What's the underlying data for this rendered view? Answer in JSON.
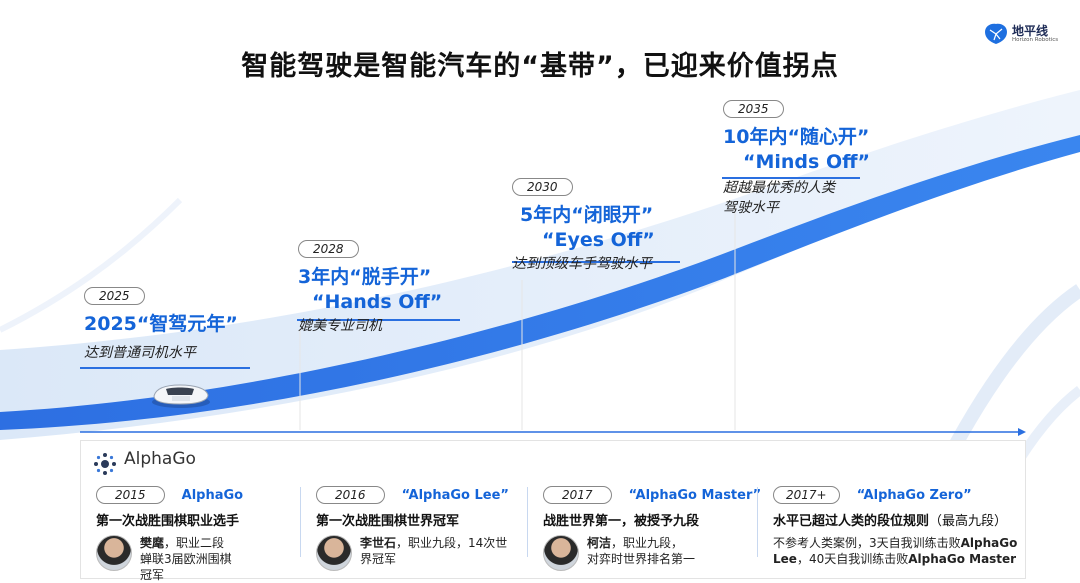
{
  "title": "智能驾驶是智能汽车的“基带”，已迎来价值拐点",
  "logo": {
    "cn": "地平线",
    "en": "Horizon Robotics"
  },
  "milestones": [
    {
      "year": "2025",
      "title": "2025“智驾元年”",
      "title2": "",
      "subtitle": "达到普通司机水平"
    },
    {
      "year": "2028",
      "title": "3年内“脱手开”",
      "title2": "“Hands Off”",
      "subtitle": "媲美专业司机"
    },
    {
      "year": "2030",
      "title": "5年内“闭眼开”",
      "title2": "“Eyes Off”",
      "subtitle": "达到顶级车手驾驶水平"
    },
    {
      "year": "2035",
      "title": "10年内“随心开”",
      "title2": "“Minds Off”",
      "subtitle": "超越最优秀的人类",
      "subtitle2": "驾驶水平"
    }
  ],
  "alphago": {
    "label": "AlphaGo",
    "columns": [
      {
        "year": "2015",
        "name": "AlphaGo",
        "desc": "第一次战胜围棋职业选手",
        "person": "樊麾",
        "person_line1": "，职业二段",
        "person_line2": "蝉联3届欧洲围棋冠军"
      },
      {
        "year": "2016",
        "name": "“AlphaGo Lee”",
        "desc": "第一次战胜围棋世界冠军",
        "person": "李世石",
        "person_line1": "，职业九段，14次世",
        "person_line2": "界冠军"
      },
      {
        "year": "2017",
        "name": "“AlphaGo Master”",
        "desc": "战胜世界第一，被授予九段",
        "person": "柯洁",
        "person_line1": "，职业九段，",
        "person_line2": "对弈时世界排名第一"
      },
      {
        "year": "2017+",
        "name": "“AlphaGo Zero”",
        "desc": "水平已超过人类的段位规则",
        "desc_suffix": "（最高九段）",
        "line1a": "不参考人类案例，3天自我训练击败",
        "line1b": "AlphaGo",
        "line2a": "Lee",
        "line2b": "，40天自我训练击败",
        "line2c": "AlphaGo Master"
      }
    ]
  },
  "colors": {
    "accent": "#1464d8",
    "road": "#2a6fe0"
  }
}
